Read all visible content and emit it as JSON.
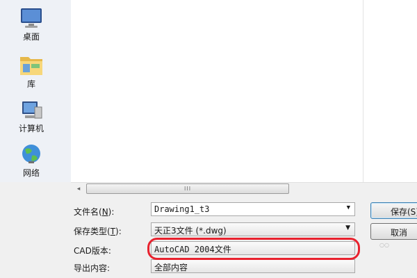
{
  "places": [
    {
      "label": "桌面",
      "icon": "desktop-icon"
    },
    {
      "label": "库",
      "icon": "library-folder-icon"
    },
    {
      "label": "计算机",
      "icon": "computer-icon"
    },
    {
      "label": "网络",
      "icon": "network-globe-icon"
    }
  ],
  "scrollbar": {
    "left_arrow": "◂",
    "right_arrow": "▸",
    "grip": "III"
  },
  "form": {
    "filename": {
      "label": "文件名(",
      "mnemonic": "N",
      "label_end": "):",
      "value": "Drawing1_t3"
    },
    "filetype": {
      "label": "保存类型(",
      "mnemonic": "T",
      "label_end": "):",
      "value": "天正3文件 (*.dwg)"
    },
    "cad_version": {
      "label": "CAD版本:",
      "value": "AutoCAD 2004文件"
    },
    "export": {
      "label": "导出内容:",
      "value": "全部内容"
    }
  },
  "buttons": {
    "save": "保存(S)",
    "cancel": "取消"
  },
  "colors": {
    "highlight": "#e8222e",
    "default_button_border": "#3c7fb1"
  }
}
